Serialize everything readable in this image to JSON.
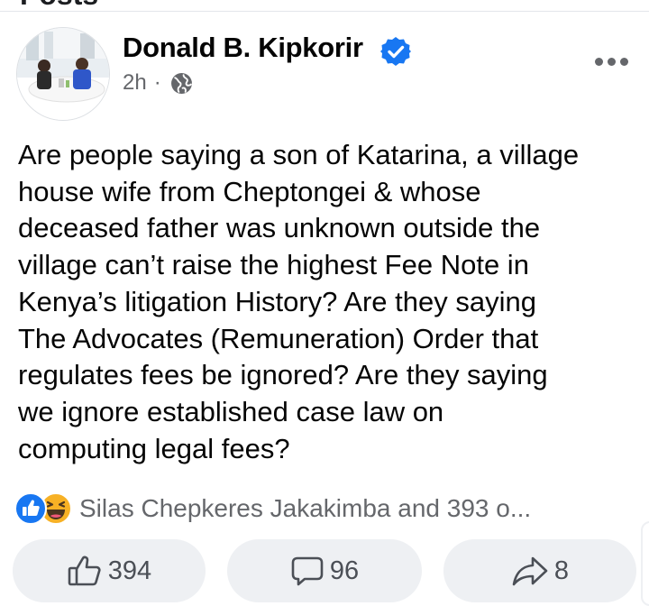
{
  "section": {
    "heading": "Posts"
  },
  "post": {
    "author": "Donald B. Kipkorir",
    "timestamp": "2h",
    "separator": "·",
    "text": "Are people saying a son of Katarina, a village\nhouse wife from Cheptongei & whose\ndeceased father was unknown outside the\nvillage can’t raise the highest Fee Note in\nKenya’s litigation History? Are they saying\nThe Advocates (Remuneration) Order that\nregulates fees be ignored? Are they saying\nwe ignore established case law on\ncomputing legal fees?",
    "reactions_summary": "Silas Chepkeres Jakakimba and 393 o..."
  },
  "actions": {
    "like_count": "394",
    "comment_count": "96",
    "share_count": "8"
  },
  "icons": {
    "verified": "verified-badge-icon",
    "privacy": "globe-icon",
    "more": "more-options-icon",
    "reaction_1": "like-reaction-icon",
    "reaction_2": "haha-reaction-icon",
    "like": "thumbs-up-icon",
    "comment": "comment-bubble-icon",
    "share": "share-arrow-icon"
  },
  "colors": {
    "brand_blue": "#1877f2",
    "secondary_text": "#65676b",
    "button_bg": "#eef0f3",
    "haha_yellow": "#f7b125"
  }
}
